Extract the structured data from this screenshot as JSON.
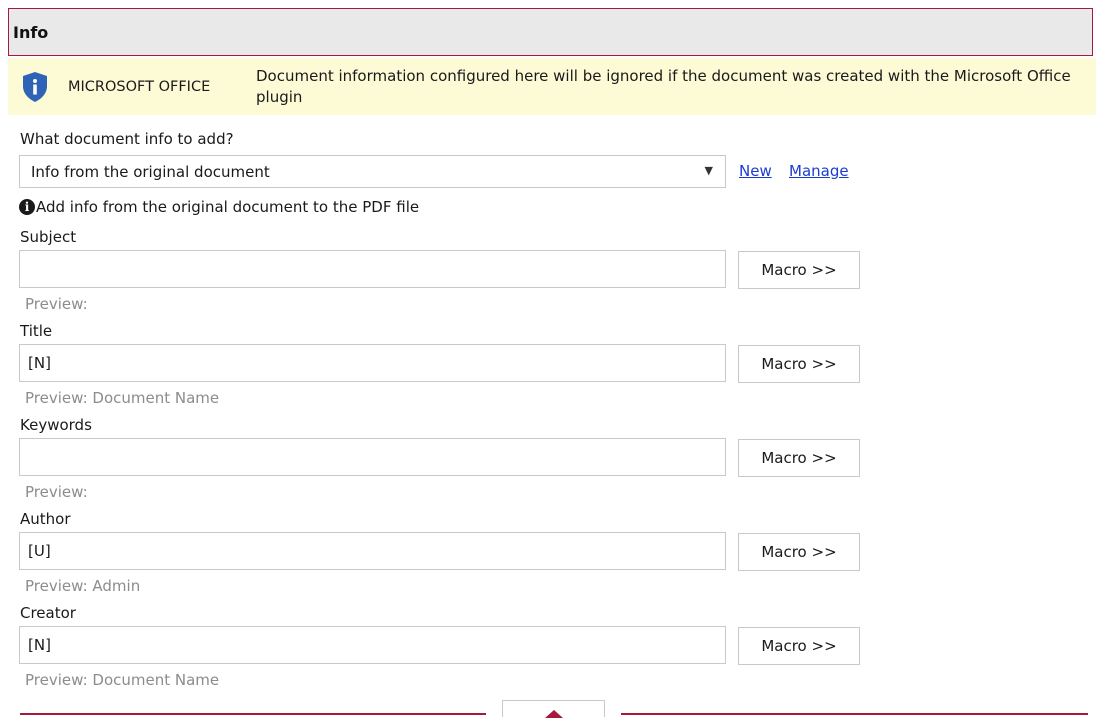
{
  "header": {
    "title": "Info"
  },
  "banner": {
    "brand": "MICROSOFT OFFICE",
    "message": "Document information configured here will be ignored if the document was created with the Microsoft Office plugin",
    "icon": "shield-info-icon",
    "shield_color": "#2f63b8"
  },
  "doc_info": {
    "question": "What document info to add?",
    "selected": "Info from the original document",
    "new_link": "New",
    "manage_link": "Manage",
    "hint": "Add info from the original document to the PDF file"
  },
  "fields": {
    "subject": {
      "label": "Subject",
      "value": "",
      "preview": "Preview:",
      "macro": "Macro >>"
    },
    "title": {
      "label": "Title",
      "value": "[N]",
      "preview": "Preview:  Document Name",
      "macro": "Macro >>"
    },
    "keywords": {
      "label": "Keywords",
      "value": "",
      "preview": "Preview:",
      "macro": "Macro >>"
    },
    "author": {
      "label": "Author",
      "value": "[U]",
      "preview": "Preview:  Admin",
      "macro": "Macro >>"
    },
    "creator": {
      "label": "Creator",
      "value": "[N]",
      "preview": "Preview:  Document Name",
      "macro": "Macro >>"
    }
  },
  "colors": {
    "accent": "#a8183c",
    "link": "#1a3dd1",
    "banner_bg": "#fdfbd6"
  }
}
